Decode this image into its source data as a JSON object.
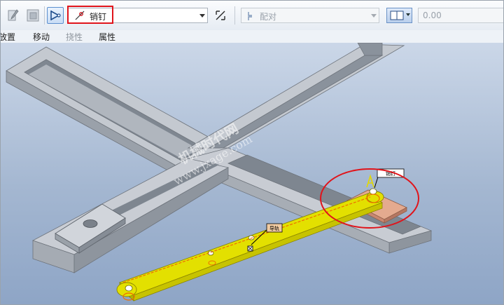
{
  "toolbar": {
    "constraint_type": "销钉",
    "constraint_icon": "pin-connection-icon",
    "flip_icon": "flip-direction-icon",
    "mate_type": "配对",
    "offset_value": "0.00"
  },
  "menu_tabs": [
    "放置",
    "移动",
    "挠性",
    "属性"
  ],
  "watermark": {
    "line1": "机械时代网",
    "line2": "www.jxage.com"
  },
  "model_tags": {
    "tag_a": "A",
    "tag_upper": "销钉",
    "tag_lower": "导轨"
  },
  "colors": {
    "highlight_red": "#e0141b",
    "part_yellow": "#e3e000",
    "frame_gray": "#b9bfc7",
    "viewport_bg": "#a4b7d1"
  }
}
